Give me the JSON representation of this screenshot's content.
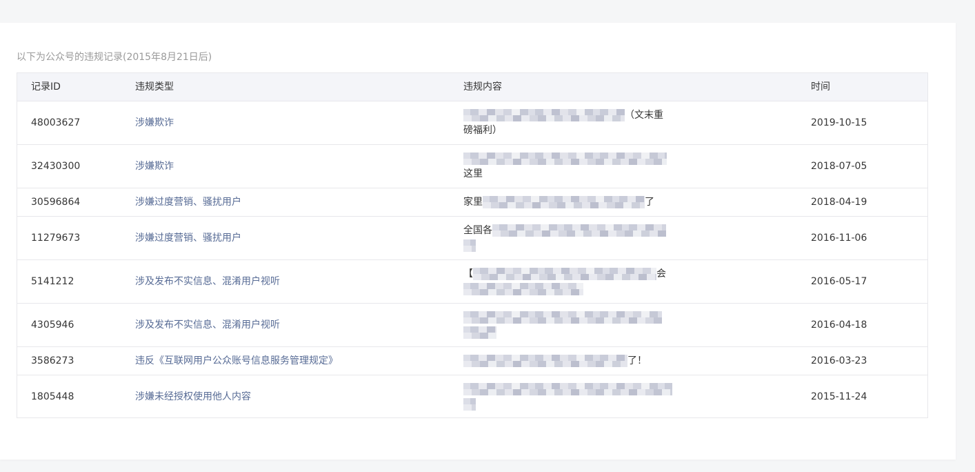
{
  "caption": "以下为公众号的违规记录(2015年8月21日后)",
  "columns": {
    "id": "记录ID",
    "type": "违规类型",
    "content": "违规内容",
    "time": "时间"
  },
  "rows": [
    {
      "id": "48003627",
      "type": "涉嫌欺诈",
      "content": [
        "（文末重",
        "磅福利）"
      ],
      "time": "2019-10-15"
    },
    {
      "id": "32430300",
      "type": "涉嫌欺诈",
      "content": [
        "这里"
      ],
      "time": "2018-07-05"
    },
    {
      "id": "30596864",
      "type": "涉嫌过度营销、骚扰用户",
      "content": [
        "家里",
        "了"
      ],
      "time": "2018-04-19"
    },
    {
      "id": "11279673",
      "type": "涉嫌过度营销、骚扰用户",
      "content": [
        "全国各"
      ],
      "time": "2016-11-06"
    },
    {
      "id": "5141212",
      "type": "涉及发布不实信息、混淆用户视听",
      "content": [
        "【",
        "会"
      ],
      "time": "2016-05-17"
    },
    {
      "id": "4305946",
      "type": "涉及发布不实信息、混淆用户视听",
      "content": [],
      "time": "2016-04-18"
    },
    {
      "id": "3586273",
      "type": "违反《互联网用户公众账号信息服务管理规定》",
      "content": [
        "了！"
      ],
      "time": "2016-03-23"
    },
    {
      "id": "1805448",
      "type": "涉嫌未经授权使用他人内容",
      "content": [],
      "time": "2015-11-24"
    }
  ],
  "colors": {
    "page_bg": "#f5f6f7",
    "card_bg": "#ffffff",
    "header_bg": "#f4f5f9",
    "border": "#e7e7eb",
    "text": "#353535",
    "type_link": "#576b95",
    "caption": "#9a9a9a"
  }
}
